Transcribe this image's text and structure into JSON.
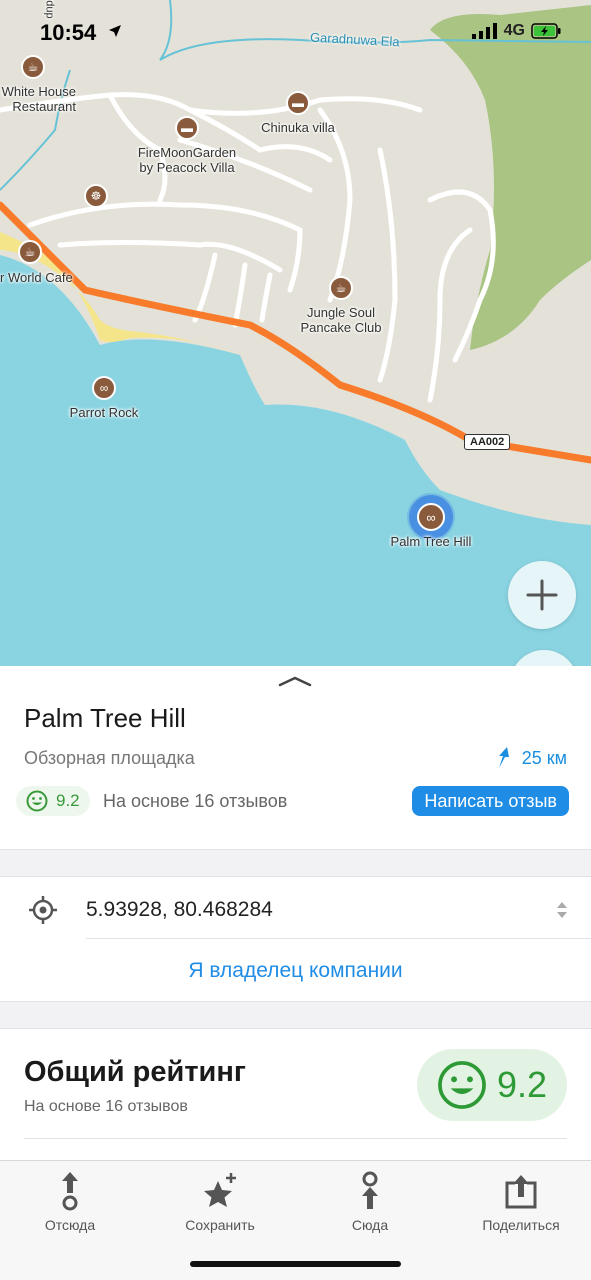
{
  "status_bar": {
    "time": "10:54",
    "network": "4G"
  },
  "map": {
    "road_label": "Garadnuwa Ela",
    "road_shield": "AA002",
    "partial_label_top": "Udup",
    "pois": [
      {
        "name": "White House\nRestaurant",
        "icon": "cafe-icon"
      },
      {
        "name": "FireMoonGarden\nby Peacock Villa",
        "icon": "hotel-icon"
      },
      {
        "name": "Chinuka villa",
        "icon": "hotel-icon"
      },
      {
        "name": "r World Cafe",
        "icon": "cafe-icon"
      },
      {
        "name": "Jungle Soul\nPancake Club",
        "icon": "cafe-icon"
      },
      {
        "name": "Parrot Rock",
        "icon": "binoculars-icon"
      },
      {
        "name": "Palm Tree Hill",
        "icon": "binoculars-icon"
      }
    ],
    "zoom_in_label": "+"
  },
  "place": {
    "title": "Palm Tree Hill",
    "type": "Обзорная площадка",
    "distance": "25 км",
    "rating": "9.2",
    "reviews": "На основе 16 отзывов",
    "write_review": "Написать отзыв"
  },
  "details": {
    "coordinates": "5.93928, 80.468284",
    "owner_link": "Я владелец компании"
  },
  "overall": {
    "title": "Общий рейтинг",
    "subtitle": "На основе 16 отзывов",
    "score": "9.2"
  },
  "tabbar": {
    "items": [
      {
        "label": "Отсюда",
        "icon": "route-from-icon"
      },
      {
        "label": "Сохранить",
        "icon": "star-add-icon"
      },
      {
        "label": "Сюда",
        "icon": "route-to-icon"
      },
      {
        "label": "Поделиться",
        "icon": "share-icon"
      }
    ]
  },
  "colors": {
    "accent": "#1f8ce6",
    "rating_green": "#2e9a36",
    "road_orange": "#f77b2a",
    "water": "#8ad4e2"
  }
}
